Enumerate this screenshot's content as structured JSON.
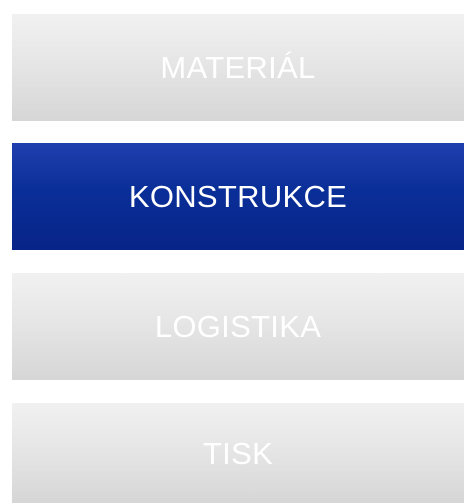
{
  "menu": {
    "items": [
      {
        "label": "MATERIÁL",
        "active": false
      },
      {
        "label": "KONSTRUKCE",
        "active": true
      },
      {
        "label": "LOGISTIKA",
        "active": false
      },
      {
        "label": "TISK",
        "active": false
      }
    ]
  },
  "colors": {
    "active_background": "#0a2e98",
    "inactive_background": "#e3e3e3",
    "label_text": "#ffffff"
  }
}
